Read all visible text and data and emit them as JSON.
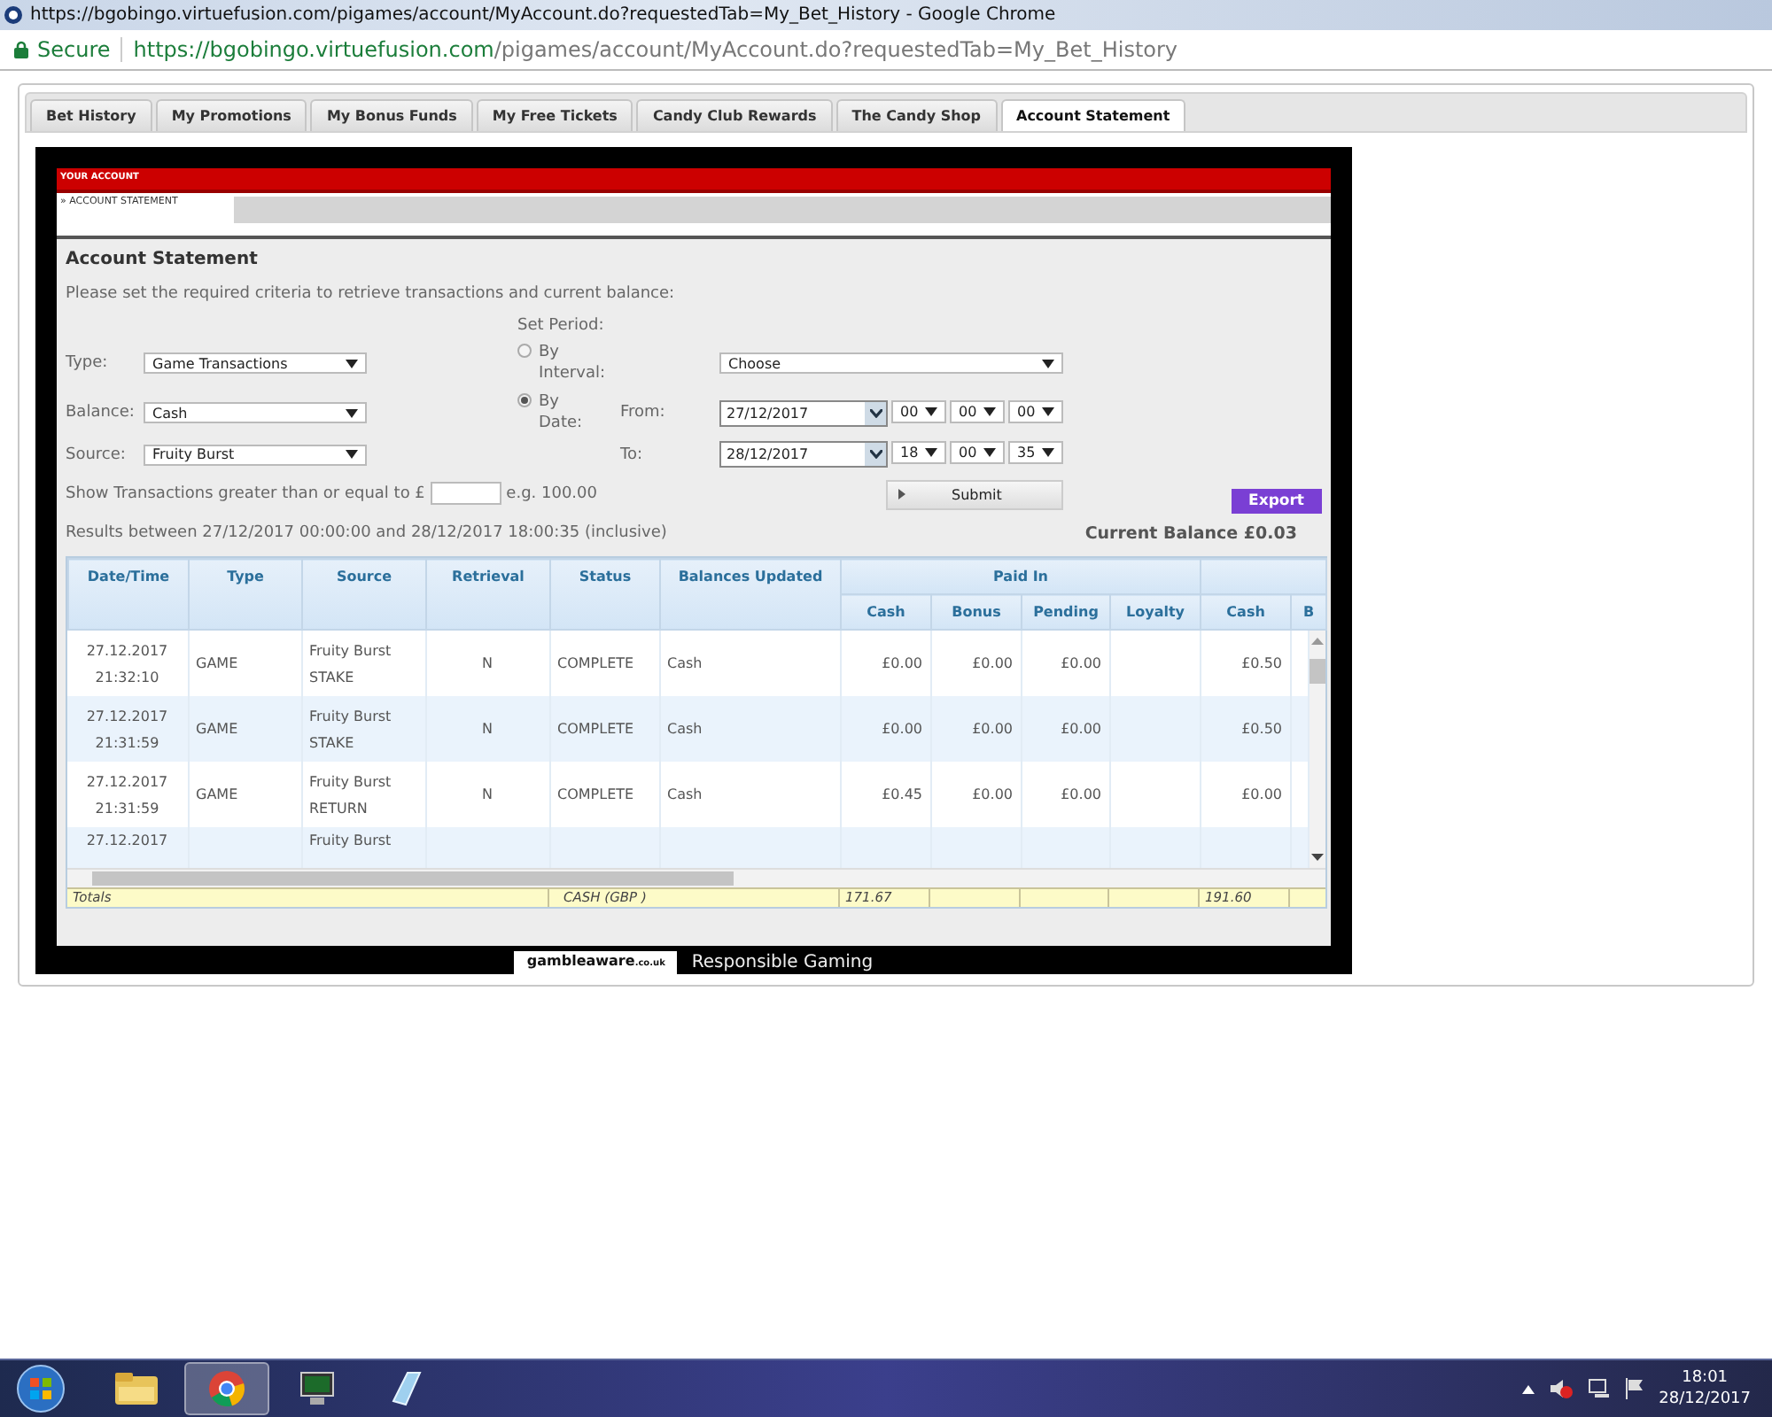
{
  "browser": {
    "title": "https://bgobingo.virtuefusion.com/pigames/account/MyAccount.do?requestedTab=My_Bet_History - Google Chrome",
    "secure_label": "Secure",
    "url_host": "https://bgobingo.virtuefusion.com",
    "url_path": "/pigames/account/MyAccount.do?requestedTab=My_Bet_History"
  },
  "tabs": [
    {
      "label": "Bet History",
      "selected": false
    },
    {
      "label": "My Promotions",
      "selected": false
    },
    {
      "label": "My Bonus Funds",
      "selected": false
    },
    {
      "label": "My Free Tickets",
      "selected": false
    },
    {
      "label": "Candy Club Rewards",
      "selected": false
    },
    {
      "label": "The Candy Shop",
      "selected": false
    },
    {
      "label": "Account Statement",
      "selected": true
    }
  ],
  "account": {
    "header": "YOUR ACCOUNT",
    "breadcrumb": "» ACCOUNT STATEMENT"
  },
  "form": {
    "title": "Account Statement",
    "instructions": "Please set the required criteria to retrieve transactions and current balance:",
    "type": {
      "label": "Type:",
      "value": "Game Transactions"
    },
    "balance": {
      "label": "Balance:",
      "value": "Cash"
    },
    "source": {
      "label": "Source:",
      "value": "Fruity Burst"
    },
    "set_period": "Set Period:",
    "period": [
      {
        "label": "By Interval:",
        "selected": false
      },
      {
        "label": "By Date:",
        "selected": true
      }
    ],
    "interval": {
      "value": "Choose"
    },
    "from": {
      "label": "From:",
      "date": "27/12/2017",
      "hour": "00",
      "minute": "00",
      "second": "00"
    },
    "to": {
      "label": "To:",
      "date": "28/12/2017",
      "hour": "18",
      "minute": "00",
      "second": "35"
    },
    "threshold": {
      "label": "Show Transactions greater than or equal to £",
      "hint": "e.g. 100.00"
    },
    "submit": "Submit",
    "export": "Export"
  },
  "results": {
    "summary": "Results between 27/12/2017 00:00:00 and 28/12/2017 18:00:35  (inclusive)",
    "current_balance": "Current Balance £0.03"
  },
  "table": {
    "columns": [
      "Date/Time",
      "Type",
      "Source",
      "Retrieval",
      "Status",
      "Balances Updated"
    ],
    "paid_in": {
      "label": "Paid In",
      "columns": [
        "Cash",
        "Bonus",
        "Pending",
        "Loyalty"
      ]
    },
    "group_2": {
      "columns": [
        "Cash",
        "B"
      ]
    },
    "rows": [
      {
        "date": "27.12.2017",
        "time": "21:32:10",
        "type": "GAME",
        "source": "Fruity Burst",
        "source_detail": "STAKE",
        "retrieval": "N",
        "status": "COMPLETE",
        "balances_updated": "Cash",
        "paid_in": [
          "£0.00",
          "£0.00",
          "£0.00"
        ],
        "column_11": "£0.50"
      },
      {
        "date": "27.12.2017",
        "time": "21:31:59",
        "type": "GAME",
        "source": "Fruity Burst",
        "source_detail": "STAKE",
        "retrieval": "N",
        "status": "COMPLETE",
        "balances_updated": "Cash",
        "paid_in": [
          "£0.00",
          "£0.00",
          "£0.00"
        ],
        "column_11": "£0.50"
      },
      {
        "date": "27.12.2017",
        "time": "21:31:59",
        "type": "GAME",
        "source": "Fruity Burst",
        "source_detail": "RETURN",
        "retrieval": "N",
        "status": "COMPLETE",
        "balances_updated": "Cash",
        "paid_in": [
          "£0.45",
          "£0.00",
          "£0.00"
        ],
        "column_11": "£0.00"
      },
      {
        "date": "27.12.2017",
        "source": "Fruity Burst"
      }
    ],
    "totals": {
      "label": "Totals",
      "balance": "CASH (GBP )",
      "paid_in_cash": "171.67",
      "column_11": "191.60"
    }
  },
  "footer": {
    "logo_main": "gambleaware",
    "logo_suffix": ".co.uk",
    "text": "Responsible Gaming"
  },
  "taskbar": {
    "time": "18:01",
    "date": "28/12/2017"
  }
}
